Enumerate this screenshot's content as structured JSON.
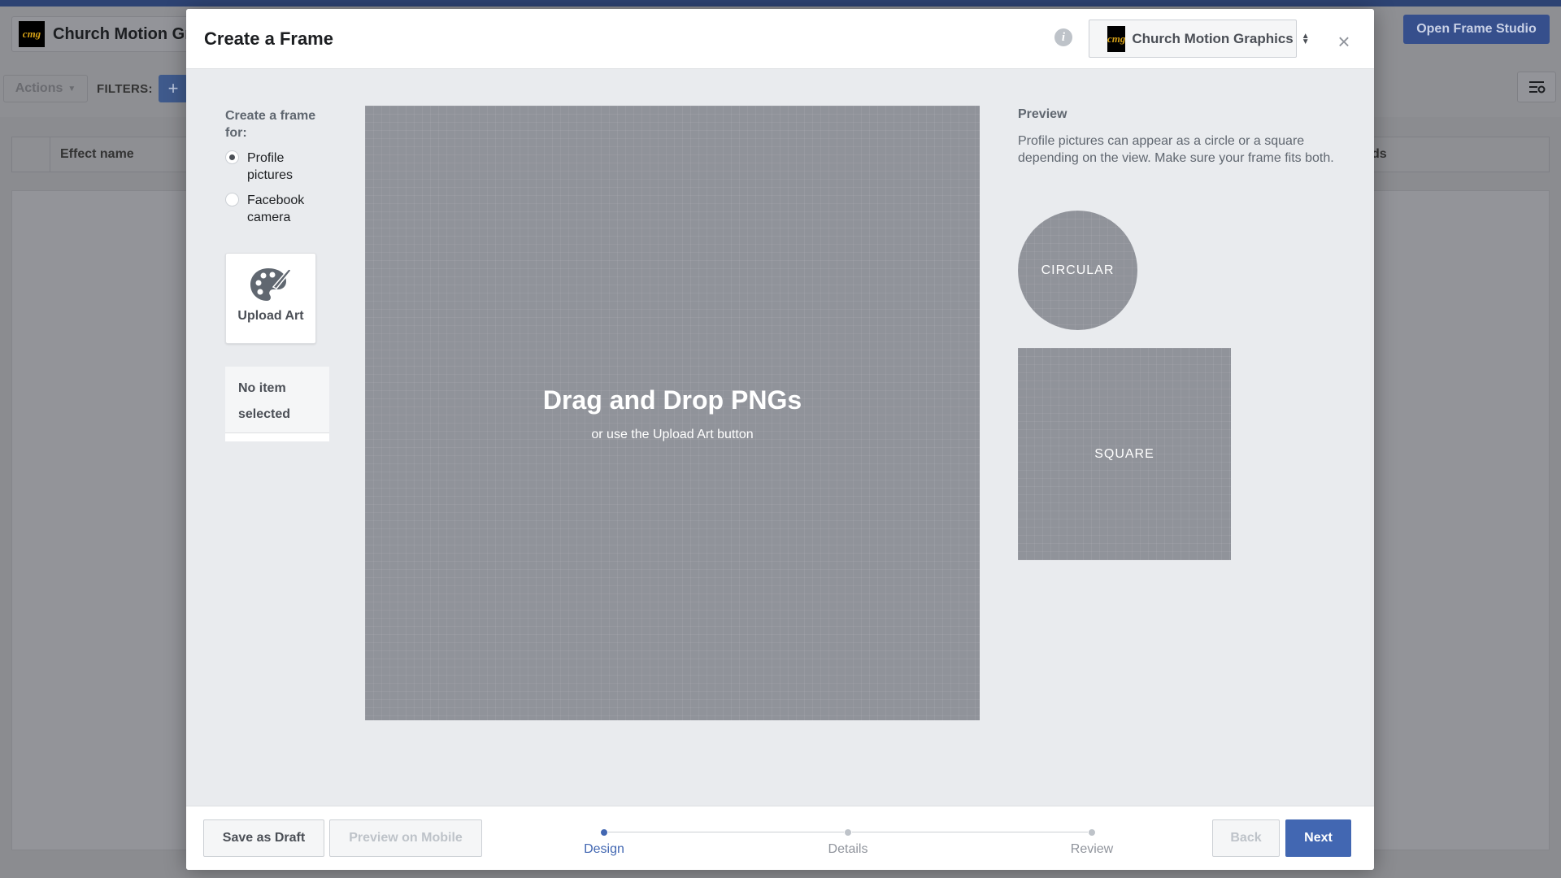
{
  "background": {
    "page_title": "Church Motion Gra",
    "logo_text": "cmg",
    "open_studio_label": "Open Frame Studio",
    "actions_label": "Actions",
    "filters_label": "FILTERS:",
    "plus_label": "+",
    "table_header_effect": "Effect name",
    "table_header_right": "ds"
  },
  "modal": {
    "title": "Create a Frame",
    "info_glyph": "i",
    "page_selector": {
      "logo_text": "cmg",
      "name": "Church Motion Graphics"
    },
    "close_glyph": "×",
    "create_for_label": "Create a frame for:",
    "options": [
      {
        "label": "Profile pictures",
        "checked": true
      },
      {
        "label": "Facebook camera",
        "checked": false
      }
    ],
    "upload_art_label": "Upload Art",
    "no_item_text": "No item selected",
    "canvas": {
      "title": "Drag and Drop PNGs",
      "subtitle": "or use the Upload Art button"
    },
    "preview": {
      "title": "Preview",
      "description": "Profile pictures can appear as a circle or a square depending on the view. Make sure your frame fits both.",
      "circular_label": "CIRCULAR",
      "square_label": "SQUARE"
    },
    "footer": {
      "save_draft": "Save as Draft",
      "preview_mobile": "Preview on Mobile",
      "back": "Back",
      "next": "Next",
      "steps": [
        "Design",
        "Details",
        "Review"
      ],
      "active_step": 0
    }
  },
  "colors": {
    "accent": "#4267b2",
    "overlay": "#8b8c90",
    "canvas": "#90939a"
  }
}
